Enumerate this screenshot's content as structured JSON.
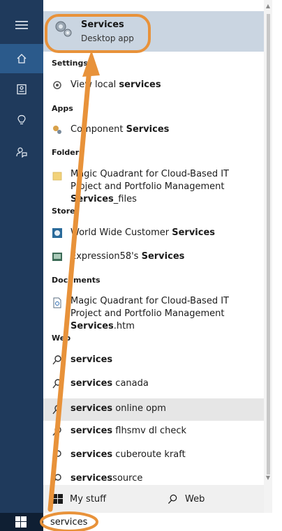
{
  "sidebar": {
    "buttons": [
      {
        "name": "menu"
      },
      {
        "name": "home"
      },
      {
        "name": "notebook"
      },
      {
        "name": "ideas"
      },
      {
        "name": "feedback"
      }
    ]
  },
  "best_match": {
    "title": "Services",
    "subtitle": "Desktop app"
  },
  "sections": {
    "settings": "Settings",
    "apps": "Apps",
    "folders": "Folders",
    "store": "Store",
    "documents": "Documents",
    "web": "Web"
  },
  "results": {
    "settings_item": {
      "pre": "View local ",
      "bold": "services"
    },
    "apps_item": {
      "pre": "Component ",
      "bold": "Services"
    },
    "folder_item": {
      "pre": "Magic Quadrant for Cloud-Based IT Project and Portfolio Management ",
      "bold": "Services",
      "post": "_files"
    },
    "store_item1": {
      "pre": "World Wide Customer ",
      "bold": "Services"
    },
    "store_item2": {
      "pre": "Expression58's ",
      "bold": "Services"
    },
    "doc_item": {
      "pre": "Magic Quadrant for Cloud-Based IT Project and Portfolio Management ",
      "bold": "Services",
      "post": ".htm"
    },
    "web_items": [
      {
        "bold": "services",
        "post": ""
      },
      {
        "bold": "services",
        "post": " canada"
      },
      {
        "bold": "services",
        "post": " online opm"
      },
      {
        "bold": "services",
        "post": " flhsmv dl check"
      },
      {
        "bold": "services",
        "post": " cuberoute kraft"
      },
      {
        "bold": "services",
        "post": "source"
      }
    ]
  },
  "bottom_bar": {
    "my_stuff": "My stuff",
    "web": "Web"
  },
  "search": {
    "value": "services"
  },
  "colors": {
    "sidebar": "#1f3a5c",
    "highlight": "#cad5e1",
    "annotation": "#e8923a"
  }
}
